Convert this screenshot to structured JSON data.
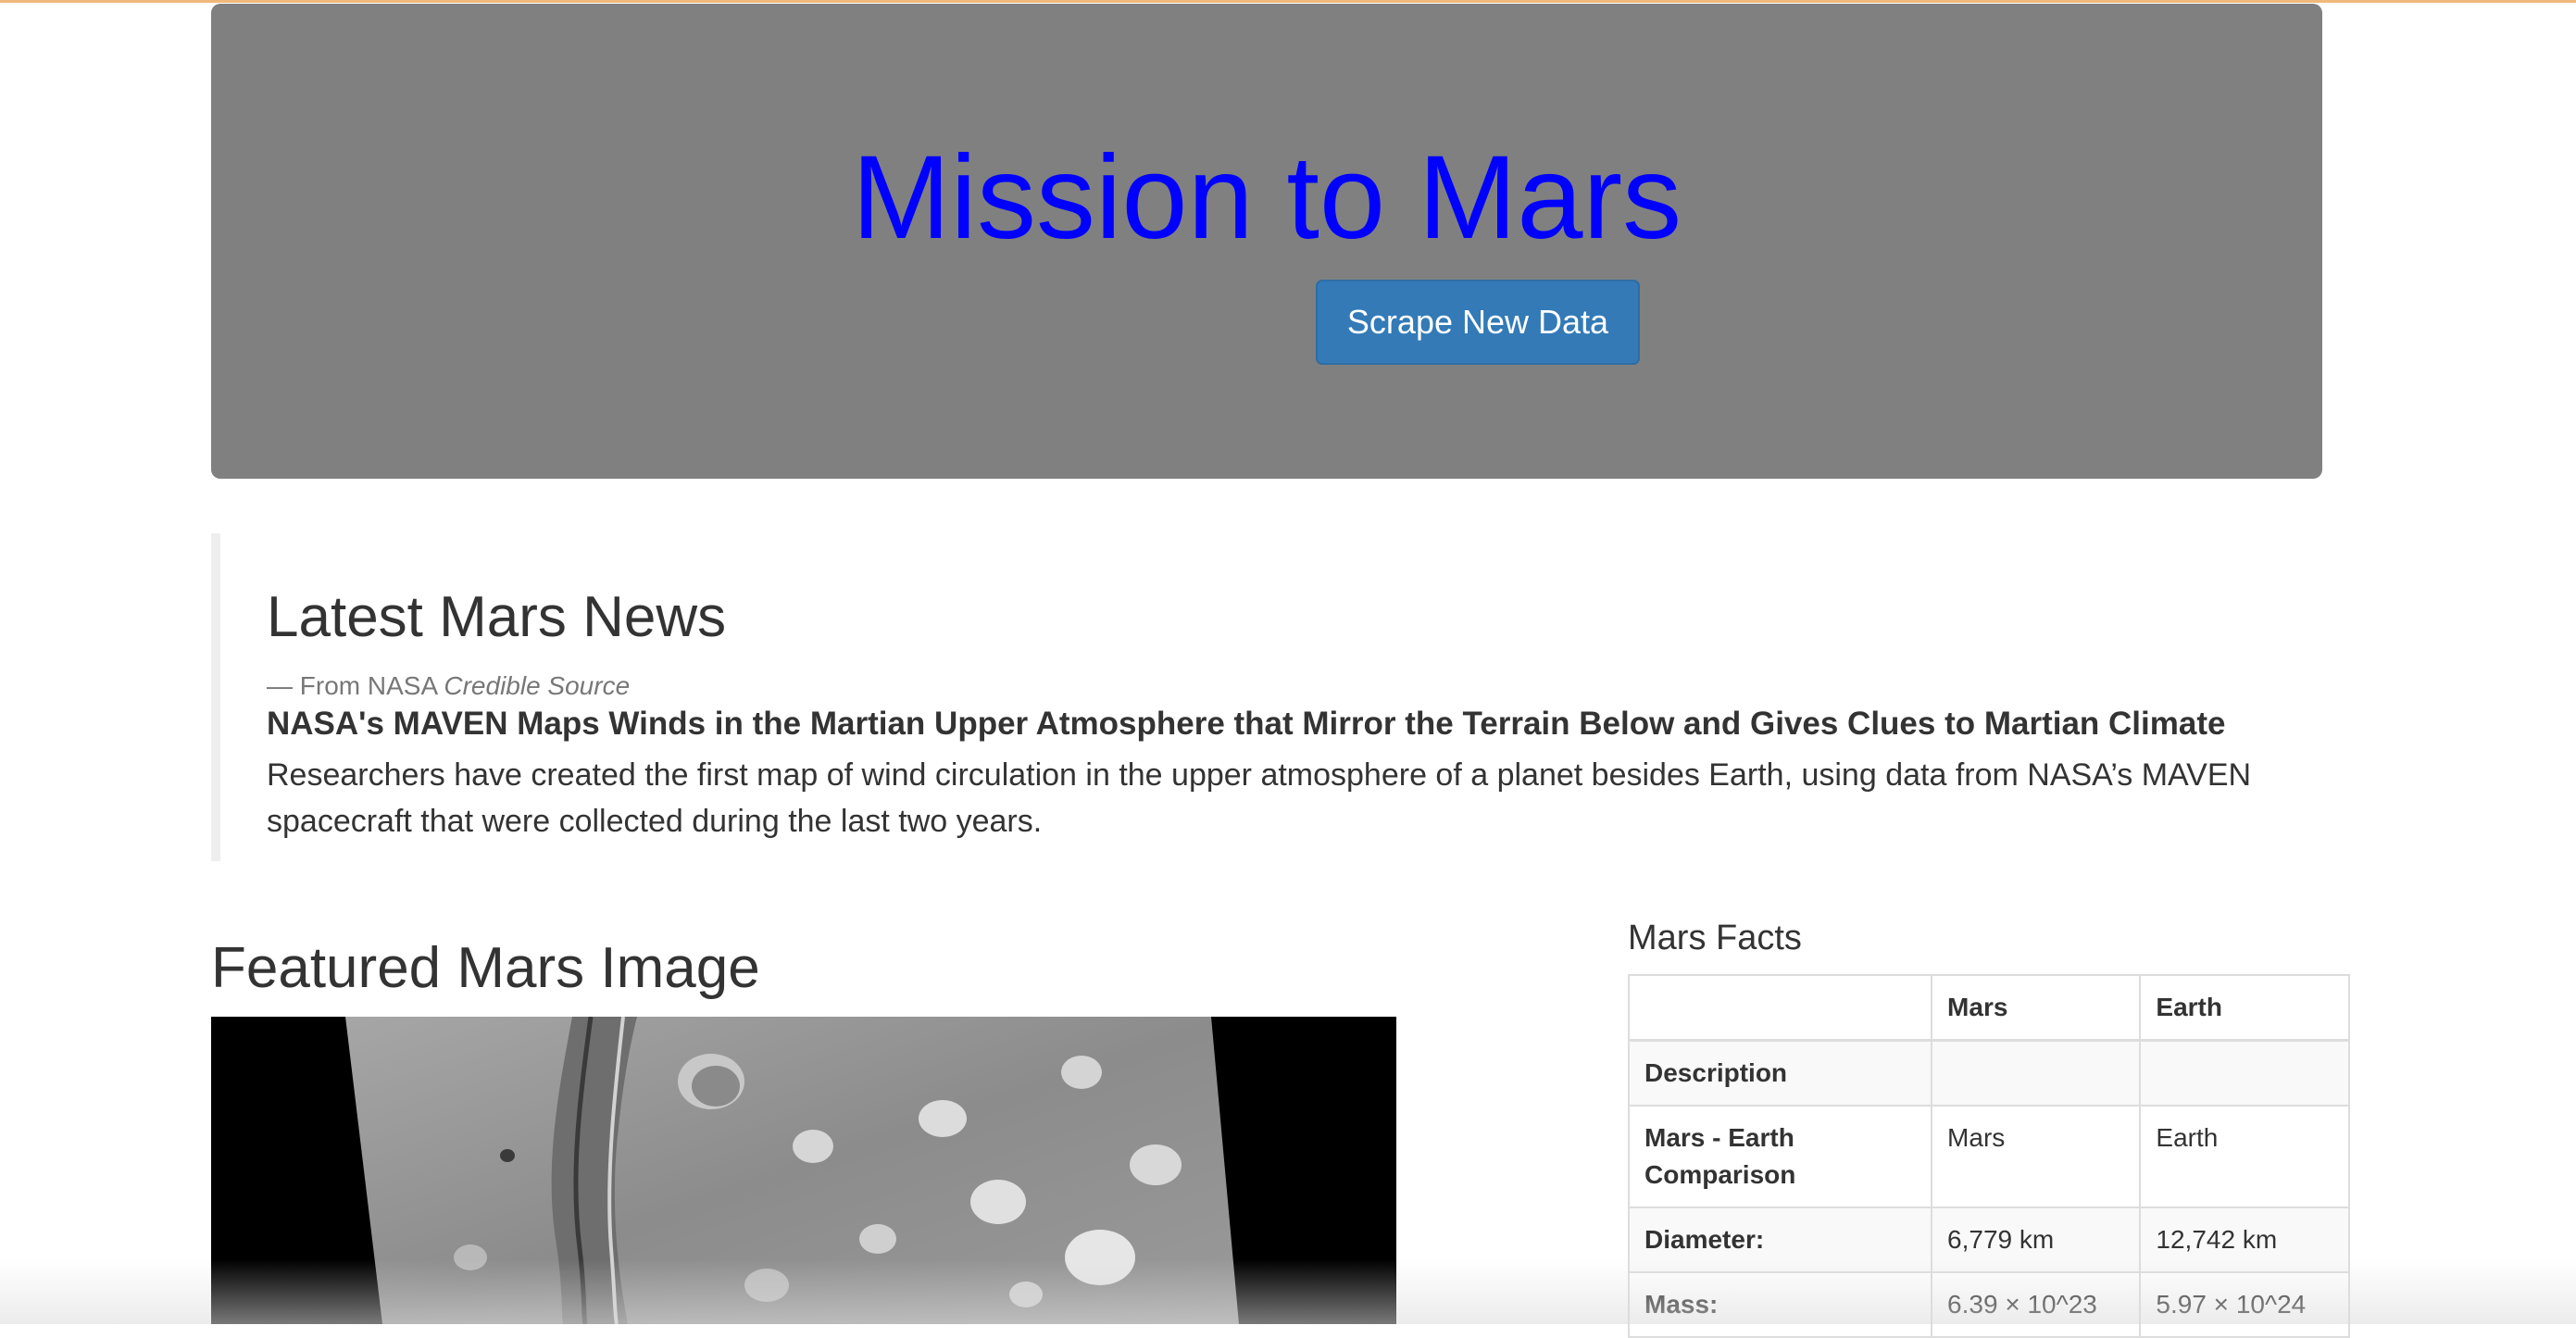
{
  "jumbotron": {
    "title": "Mission to Mars",
    "button_label": "Scrape New Data"
  },
  "news": {
    "heading": "Latest Mars News",
    "source_prefix": "— From NASA",
    "source_emphasis": "Credible Source",
    "title": "NASA's MAVEN Maps Winds in the Martian Upper Atmosphere that Mirror the Terrain Below and Gives Clues to Martian Climate",
    "paragraph": "Researchers have created the first map of wind circulation in the upper atmosphere of a planet besides Earth, using data from NASA’s MAVEN spacecraft that were collected during the last two years."
  },
  "featured": {
    "heading": "Featured Mars Image",
    "image_icon": "mars-surface-image"
  },
  "facts": {
    "heading": "Mars Facts",
    "columns": [
      "",
      "Mars",
      "Earth"
    ],
    "rows": [
      {
        "label": "Description",
        "mars": "",
        "earth": ""
      },
      {
        "label": "Mars - Earth Comparison",
        "mars": "Mars",
        "earth": "Earth"
      },
      {
        "label": "Diameter:",
        "mars": "6,779 km",
        "earth": "12,742 km"
      },
      {
        "label": "Mass:",
        "mars": "6.39 × 10^23",
        "earth": "5.97 × 10^24"
      }
    ]
  },
  "colors": {
    "jumbotron_bg": "#808080",
    "title_color": "#0000ff",
    "button_bg": "#337ab7",
    "top_rule": "#f0b87a"
  }
}
